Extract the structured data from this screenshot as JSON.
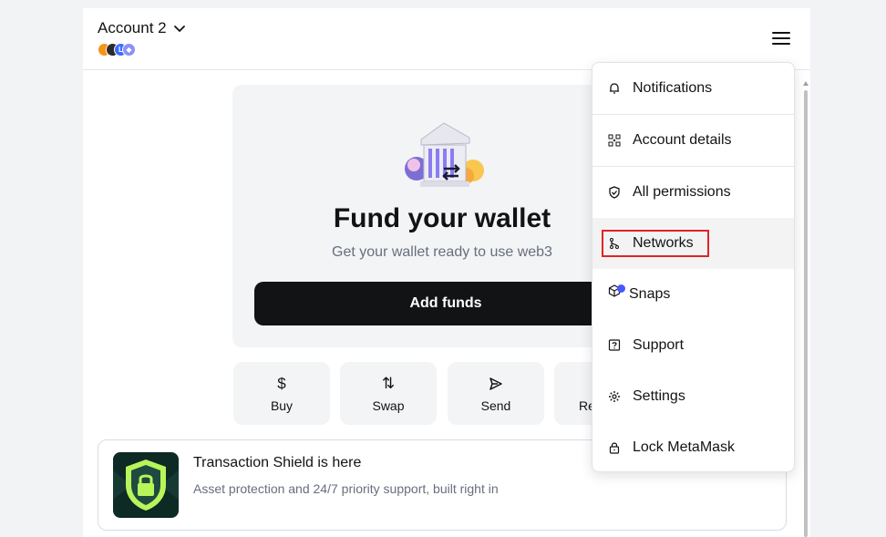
{
  "header": {
    "account_name": "Account 2",
    "network_avatars": [
      {
        "name": "bitcoin",
        "color": "#f7931a",
        "glyph": ""
      },
      {
        "name": "ethereum-dark",
        "color": "#2b2b2b",
        "glyph": ""
      },
      {
        "name": "linea",
        "color": "#3d6dff",
        "glyph": "L"
      },
      {
        "name": "ethereum",
        "color": "#8a92f7",
        "glyph": "◆"
      }
    ]
  },
  "fund_card": {
    "title": "Fund your wallet",
    "subtitle": "Get your wallet ready to use web3",
    "button_label": "Add funds"
  },
  "actions": [
    {
      "label": "Buy",
      "icon": "dollar-icon",
      "glyph": "$"
    },
    {
      "label": "Swap",
      "icon": "swap-icon",
      "glyph": "⇅"
    },
    {
      "label": "Send",
      "icon": "send-icon",
      "glyph": ""
    },
    {
      "label": "Re",
      "icon": "receive-icon",
      "glyph": ""
    }
  ],
  "shield": {
    "title": "Transaction Shield is here",
    "description": "Asset protection and 24/7 priority support, built right in"
  },
  "menu": {
    "items": [
      {
        "label": "Notifications",
        "icon": "bell-icon"
      },
      {
        "label": "Account details",
        "icon": "qr-code-icon"
      },
      {
        "label": "All permissions",
        "icon": "shield-check-icon"
      },
      {
        "label": "Networks",
        "icon": "network-icon"
      },
      {
        "label": "Snaps",
        "icon": "cube-icon"
      },
      {
        "label": "Support",
        "icon": "question-icon"
      },
      {
        "label": "Settings",
        "icon": "gear-icon"
      },
      {
        "label": "Lock MetaMask",
        "icon": "lock-icon"
      }
    ]
  },
  "colors": {
    "primary_text": "#121314",
    "muted_text": "#686e7d",
    "button_dark": "#121314",
    "card_bg": "#f3f4f6",
    "highlight": "#e02424",
    "notification_dot": "#4459ff"
  }
}
